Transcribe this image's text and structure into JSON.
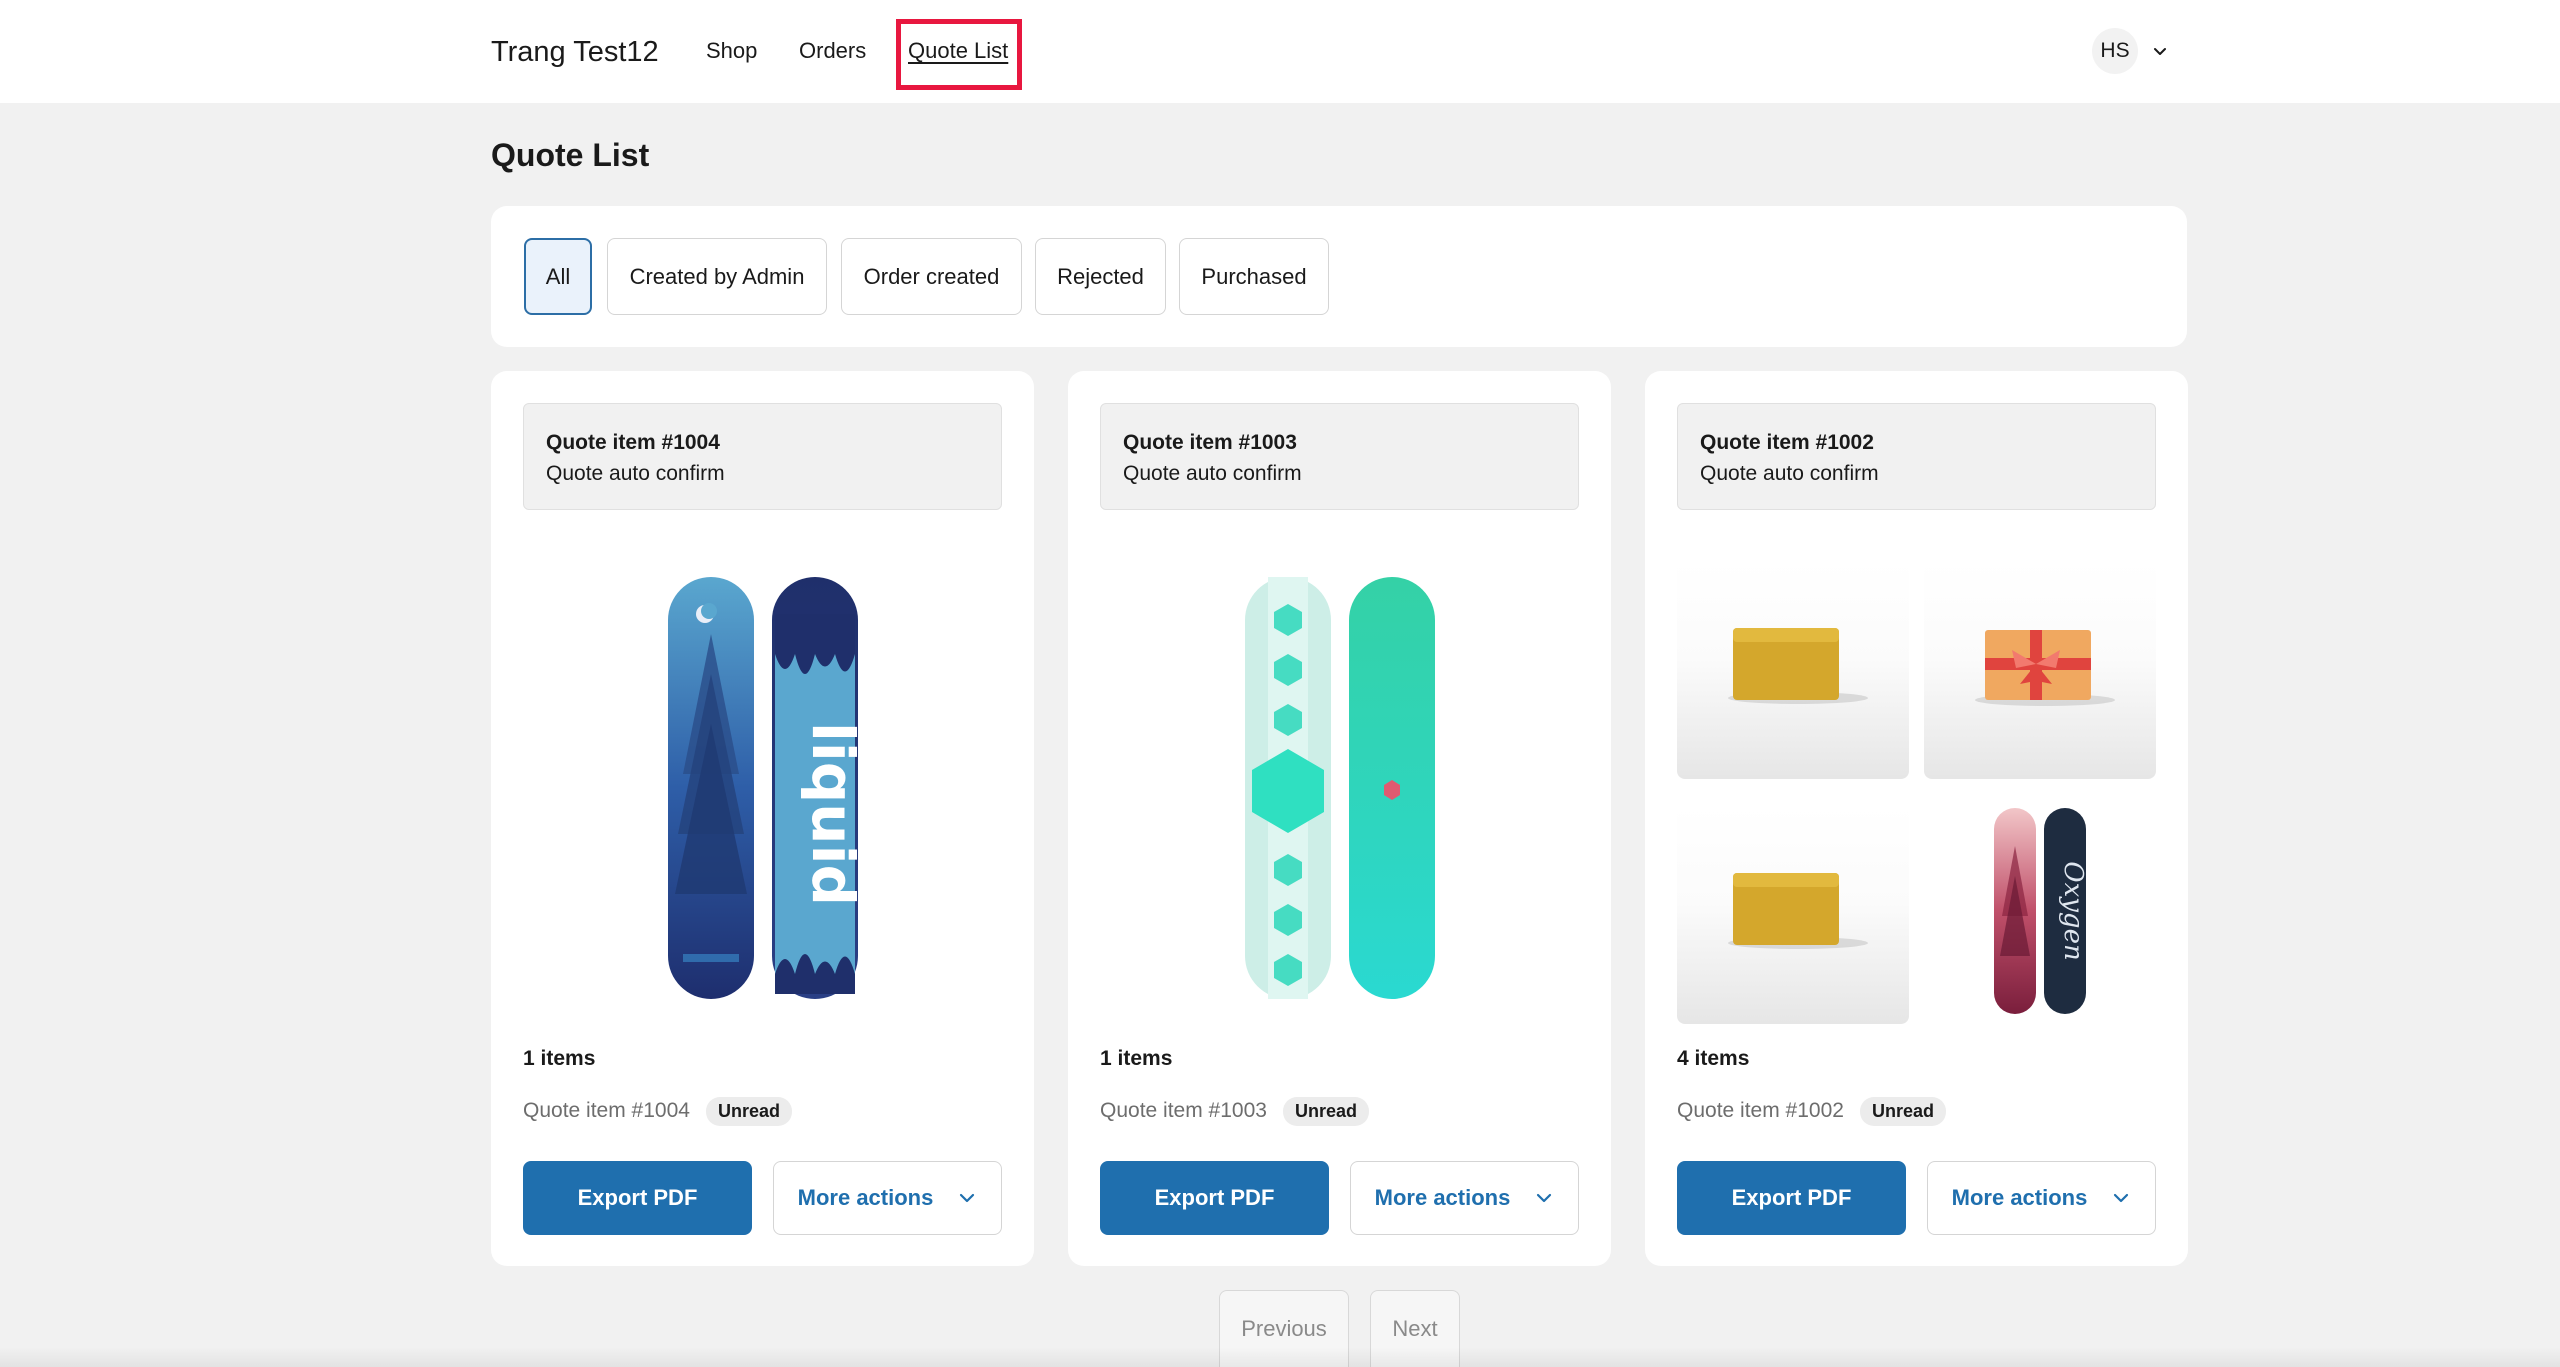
{
  "header": {
    "brand": "Trang Test12",
    "nav": [
      {
        "label": "Shop"
      },
      {
        "label": "Orders"
      },
      {
        "label": "Quote List"
      }
    ],
    "account": {
      "initials": "HS"
    }
  },
  "page_title": "Quote List",
  "filters": [
    {
      "label": "All",
      "active": true
    },
    {
      "label": "Created by Admin",
      "active": false
    },
    {
      "label": "Order created",
      "active": false
    },
    {
      "label": "Rejected",
      "active": false
    },
    {
      "label": "Purchased",
      "active": false
    }
  ],
  "quotes": [
    {
      "title": "Quote item #1004",
      "subtitle": "Quote auto confirm",
      "items_count": "1 items",
      "ref": "Quote item #1004",
      "badge": "Unread",
      "export_label": "Export PDF",
      "more_label": "More actions",
      "images": [
        "snowboard-liquid"
      ]
    },
    {
      "title": "Quote item #1003",
      "subtitle": "Quote auto confirm",
      "items_count": "1 items",
      "ref": "Quote item #1003",
      "badge": "Unread",
      "export_label": "Export PDF",
      "more_label": "More actions",
      "images": [
        "snowboard-hexagon"
      ]
    },
    {
      "title": "Quote item #1002",
      "subtitle": "Quote auto confirm",
      "items_count": "4 items",
      "ref": "Quote item #1002",
      "badge": "Unread",
      "export_label": "Export PDF",
      "more_label": "More actions",
      "images": [
        "snowboard-wax",
        "gift-card",
        "snowboard-wax",
        "snowboard-oxygen"
      ]
    }
  ],
  "pagination": {
    "previous": "Previous",
    "next": "Next"
  },
  "colors": {
    "accent": "#1f6fae",
    "active_filter_bg": "#eaf2fb",
    "highlight": "#e8173f",
    "page_bg": "#f1f1f1"
  }
}
